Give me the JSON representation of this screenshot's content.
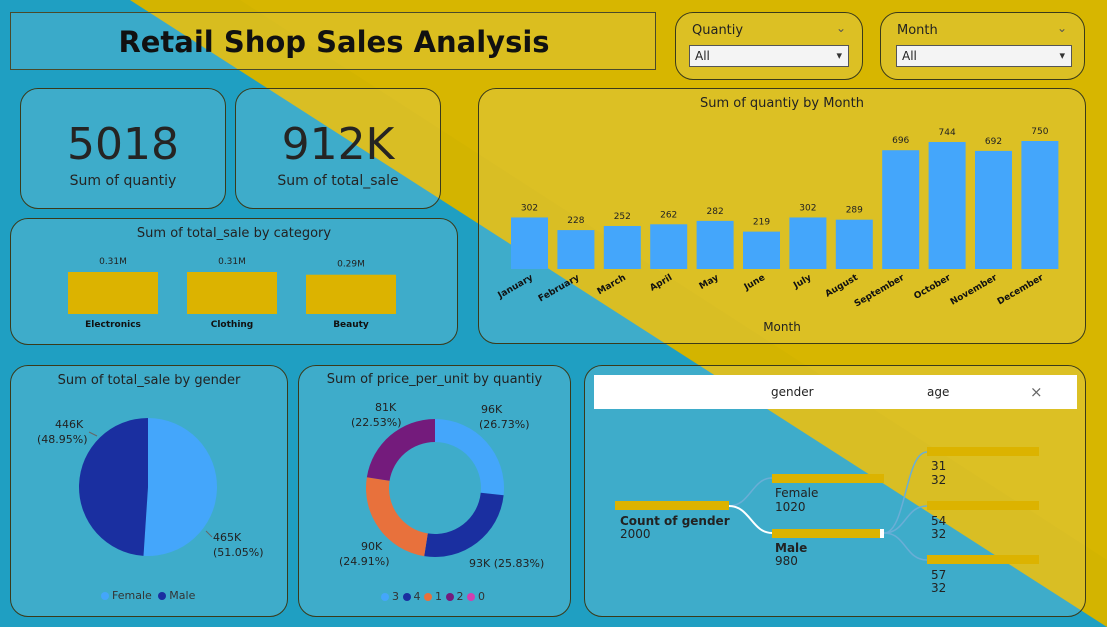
{
  "title": "Retail Shop Sales Analysis",
  "slicers": [
    {
      "label": "Quantiy",
      "value": "All"
    },
    {
      "label": "Month",
      "value": "All"
    }
  ],
  "kpis": [
    {
      "value": "5018",
      "label": "Sum of quantiy"
    },
    {
      "value": "912K",
      "label": "Sum of total_sale"
    }
  ],
  "colors": {
    "accent_blue": "#44a6fb",
    "gold": "#dcb300",
    "navy": "#1a2fa0",
    "orange": "#e8713c",
    "purple": "#741b7c",
    "pink": "#d23fb0"
  },
  "chart_data": [
    {
      "type": "bar",
      "title": "Sum of quantiy by Month",
      "xlabel": "Month",
      "categories": [
        "January",
        "February",
        "March",
        "April",
        "May",
        "June",
        "July",
        "August",
        "September",
        "October",
        "November",
        "December"
      ],
      "values": [
        302,
        228,
        252,
        262,
        282,
        219,
        302,
        289,
        696,
        744,
        692,
        750
      ],
      "labels": [
        "302",
        "228",
        "252",
        "262",
        "282",
        "219",
        "302",
        "289",
        "696",
        "744",
        "692",
        "750"
      ]
    },
    {
      "type": "bar",
      "title": "Sum of total_sale by category",
      "categories": [
        "Electronics",
        "Clothing",
        "Beauty"
      ],
      "values": [
        0.31,
        0.31,
        0.29
      ],
      "labels": [
        "0.31M",
        "0.31M",
        "0.29M"
      ]
    },
    {
      "type": "pie",
      "title": "Sum of total_sale by gender",
      "categories": [
        "Female",
        "Male"
      ],
      "values": [
        465,
        446
      ],
      "labels": [
        [
          "465K",
          "(51.05%)"
        ],
        [
          "446K",
          "(48.95%)"
        ]
      ],
      "legend": [
        "Female",
        "Male"
      ]
    },
    {
      "type": "pie",
      "title": "Sum of price_per_unit by quantiy",
      "categories": [
        "3",
        "4",
        "1",
        "2",
        "0"
      ],
      "values": [
        96,
        93,
        90,
        81,
        0
      ],
      "labels": [
        [
          "96K",
          "(26.73%)"
        ],
        [
          "93K (25.83%)"
        ],
        [
          "90K",
          "(24.91%)"
        ],
        [
          "81K",
          "(22.53%)"
        ]
      ],
      "legend": [
        "3",
        "4",
        "1",
        "2",
        "0"
      ]
    }
  ],
  "decomposition_tree": {
    "headers": [
      "gender",
      "age"
    ],
    "close": "×",
    "root": {
      "label": "Count of gender",
      "value": "2000"
    },
    "nodes": [
      {
        "label": "Female",
        "value": "1020"
      },
      {
        "label": "Male",
        "value": "980"
      }
    ],
    "leaves": [
      {
        "line1": "31",
        "line2": "32"
      },
      {
        "line1": "54",
        "line2": "32"
      },
      {
        "line1": "57",
        "line2": "32"
      }
    ]
  }
}
